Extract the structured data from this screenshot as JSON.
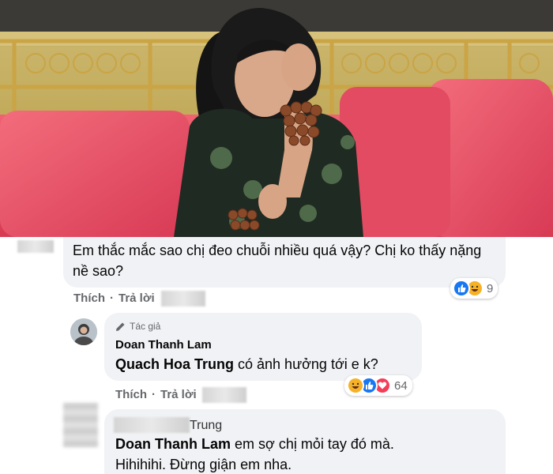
{
  "photo": {
    "alt_icon": "photo-woman-on-red-sofa"
  },
  "comments": [
    {
      "text": "Em thắc mắc sao chị đeo chuỗi nhiều quá vậy? Chị ko thấy nặng nề sao?",
      "reactions": {
        "icons": [
          "like-icon",
          "haha-icon"
        ],
        "count": "9"
      },
      "actions": {
        "like": "Thích",
        "sep": "·",
        "reply": "Trả lời"
      }
    },
    {
      "author_badge": "Tác giả",
      "name": "Doan Thanh Lam",
      "mention": "Quach Hoa Trung",
      "text": " có ảnh hưởng tới e k?",
      "reactions": {
        "icons": [
          "haha-icon",
          "like-icon",
          "love-icon"
        ],
        "count": "64"
      },
      "actions": {
        "like": "Thích",
        "sep": "·",
        "reply": "Trả lời"
      }
    },
    {
      "name_suffix": "Trung",
      "mention": "Doan Thanh Lam",
      "text_line1": " em sợ chị mỏi tay đó mà.",
      "text_line2": "Hihihihi. Đừng giận em nha."
    }
  ],
  "colors": {
    "bubble": "#f0f2f5",
    "like": "#1877f2",
    "haha": "#f7b125",
    "love": "#f33e58",
    "meta": "#65676b"
  }
}
